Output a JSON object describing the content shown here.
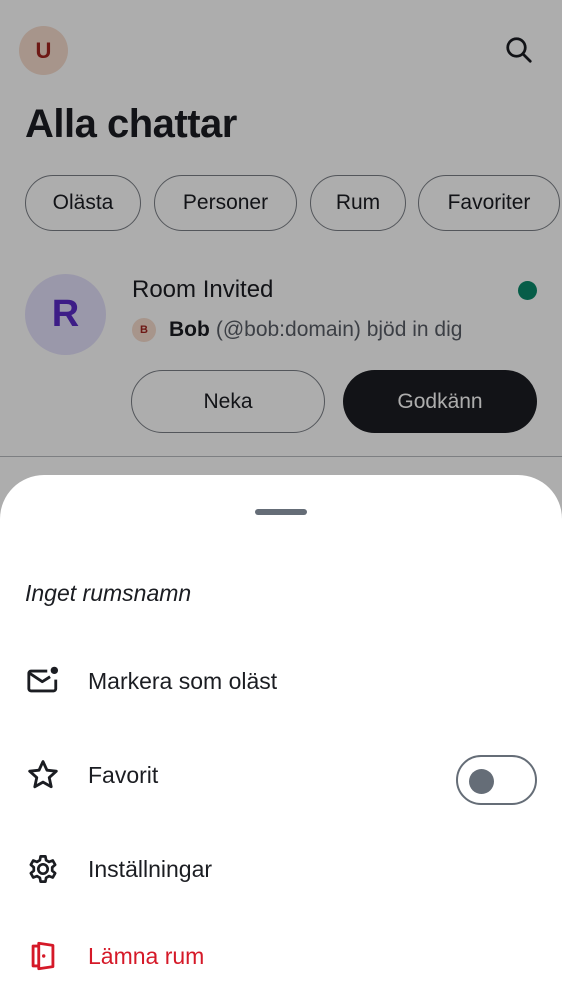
{
  "header": {
    "user_avatar_letter": "U",
    "title": "Alla chattar",
    "search_icon": "search-icon"
  },
  "filters": [
    {
      "label": "Olästa"
    },
    {
      "label": "Personer"
    },
    {
      "label": "Rum"
    },
    {
      "label": "Favoriter"
    }
  ],
  "invite": {
    "avatar_letter": "R",
    "room_name": "Room Invited",
    "unread_indicator_color": "#0a8a6a",
    "inviter_avatar_letter": "B",
    "inviter_name": "Bob",
    "inviter_text": "(@bob:domain) bjöd in dig",
    "decline_label": "Neka",
    "accept_label": "Godkänn"
  },
  "sheet": {
    "title": "Inget rumsnamn",
    "items": [
      {
        "label": "Markera som oläst",
        "icon": "mark-unread-mail-icon"
      },
      {
        "label": "Favorit",
        "icon": "star-icon",
        "toggle_on": false
      },
      {
        "label": "Inställningar",
        "icon": "gear-icon"
      },
      {
        "label": "Lämna rum",
        "icon": "leave-door-icon",
        "destructive": true
      }
    ]
  },
  "colors": {
    "accent_dark": "#1b1d22",
    "danger": "#d51928",
    "online": "#0a8a6a",
    "room_avatar_bg": "#e3e0fb",
    "room_avatar_fg": "#5a2bc8"
  }
}
